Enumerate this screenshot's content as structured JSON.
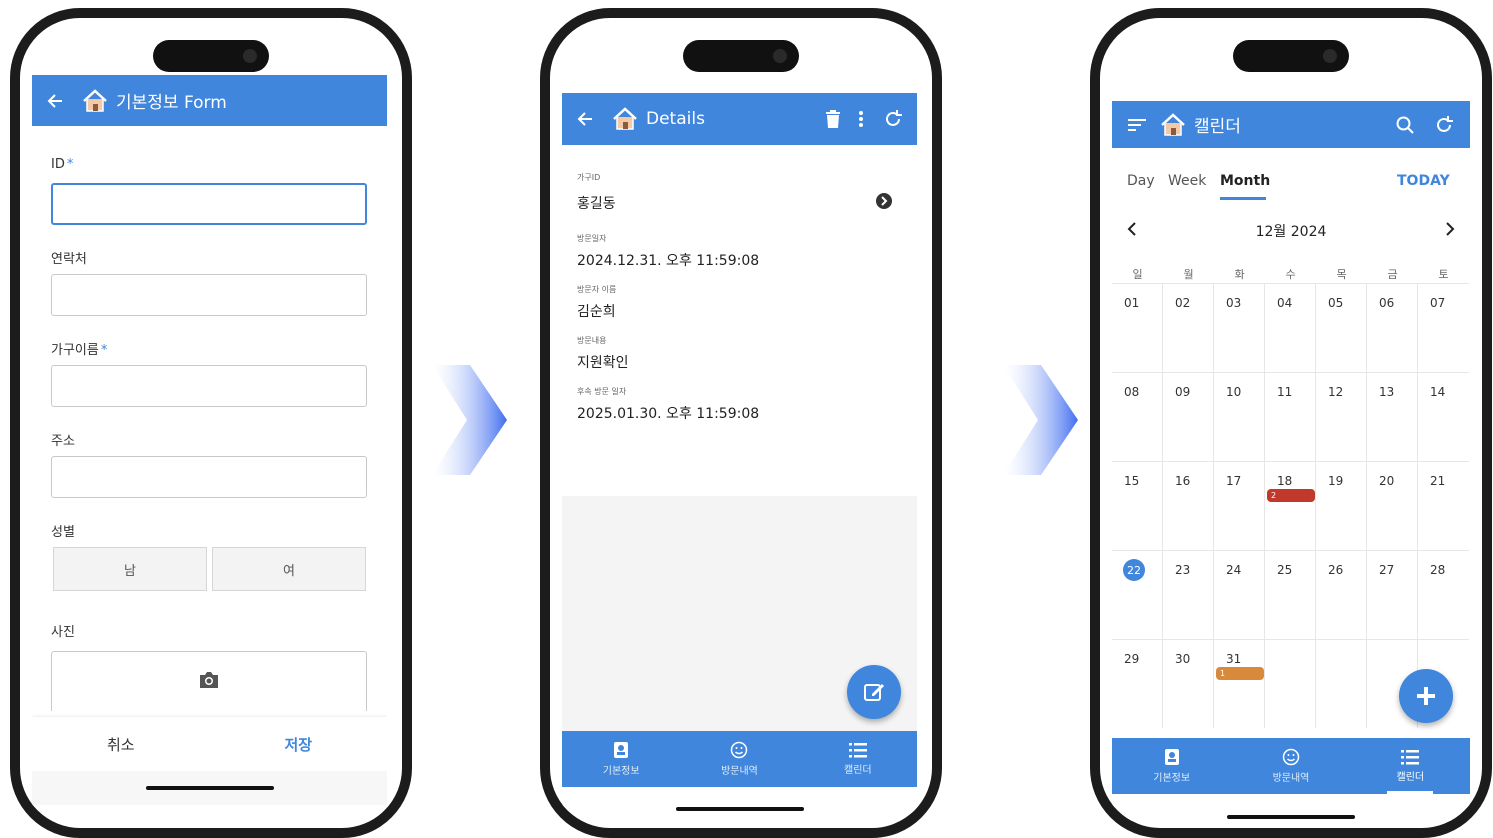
{
  "form_screen": {
    "title": "기본정보 Form",
    "fields": [
      {
        "label": "ID",
        "required": true,
        "value": ""
      },
      {
        "label": "연락처",
        "required": false,
        "value": ""
      },
      {
        "label": "가구이름",
        "required": true,
        "value": ""
      },
      {
        "label": "주소",
        "required": false,
        "value": ""
      }
    ],
    "gender_label": "성별",
    "gender_options": [
      "남",
      "여"
    ],
    "photo_label": "사진",
    "cancel_label": "취소",
    "save_label": "저장",
    "required_mark": "*"
  },
  "details_screen": {
    "title": "Details",
    "items": [
      {
        "label": "가구ID",
        "value": "홍길동"
      },
      {
        "label": "방문일자",
        "value": "2024.12.31. 오후 11:59:08"
      },
      {
        "label": "방문자 이름",
        "value": "김순희"
      },
      {
        "label": "방문내용",
        "value": "지원확인"
      },
      {
        "label": "후속 방문 일자",
        "value": "2025.01.30. 오후 11:59:08"
      }
    ],
    "nav": [
      "기본정보",
      "방문내역",
      "캘린더"
    ]
  },
  "calendar_screen": {
    "title": "캘린더",
    "views": [
      "Day",
      "Week",
      "Month"
    ],
    "active_view": "Month",
    "today_label": "TODAY",
    "month_label": "12월 2024",
    "weekdays": [
      "일",
      "월",
      "화",
      "수",
      "목",
      "금",
      "토"
    ],
    "weeks": [
      [
        "01",
        "02",
        "03",
        "04",
        "05",
        "06",
        "07"
      ],
      [
        "08",
        "09",
        "10",
        "11",
        "12",
        "13",
        "14"
      ],
      [
        "15",
        "16",
        "17",
        "18",
        "19",
        "20",
        "21"
      ],
      [
        "22",
        "23",
        "24",
        "25",
        "26",
        "27",
        "28"
      ],
      [
        "29",
        "30",
        "31",
        "",
        "",
        "",
        ""
      ]
    ],
    "today_day": "22",
    "events": [
      {
        "day": "18",
        "label": "2",
        "color": "#c0392b"
      },
      {
        "day": "31",
        "label": "1",
        "color": "#d9893a"
      }
    ],
    "nav": [
      "기본정보",
      "방문내역",
      "캘린더"
    ]
  },
  "colors": {
    "primary": "#3f86dc",
    "arrow": "#3f6df0"
  }
}
